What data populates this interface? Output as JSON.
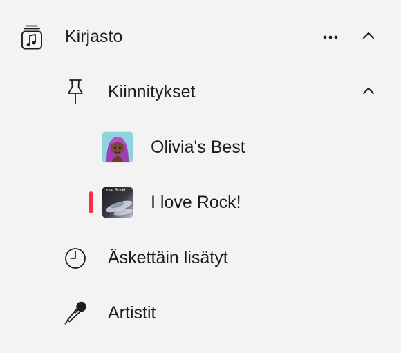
{
  "library": {
    "label": "Kirjasto",
    "more_icon": "ellipsis-icon",
    "collapse_icon": "chevron-up-icon"
  },
  "pins": {
    "label": "Kiinnitykset",
    "collapse_icon": "chevron-up-icon",
    "items": [
      {
        "label": "Olivia's Best",
        "artwork": "memoji-avatar-artwork"
      },
      {
        "label": "I love Rock!",
        "artwork": "rock-playlist-artwork",
        "artwork_text": "I love Rock!",
        "now_playing": true
      }
    ]
  },
  "recently_added": {
    "label": "Äskettäin lisätyt",
    "icon": "clock-icon"
  },
  "artists": {
    "label": "Artistit",
    "icon": "microphone-icon"
  },
  "colors": {
    "background": "#f3f3f3",
    "text": "#1d1d1f",
    "now_playing_accent": "#fa2d48",
    "avatar_background": "#8fd3dc",
    "avatar_hair": "#a13fb5",
    "avatar_skin": "#7a4a36"
  }
}
